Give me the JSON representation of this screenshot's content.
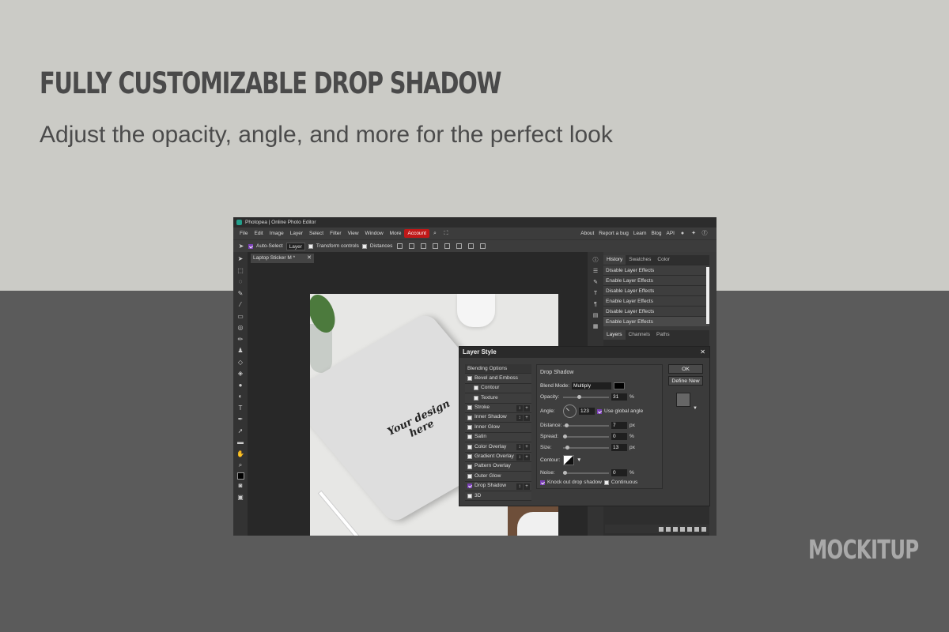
{
  "headline": "FULLY CUSTOMIZABLE DROP SHADOW",
  "subheadline": "Adjust the opacity, angle, and more for the perfect look",
  "brand": "MOCKITUP",
  "colors": {
    "top_bg": "#cbcbc6",
    "bottom_bg": "#5b5b5b",
    "accent_account": "#c01818",
    "check_purple": "#7a3fb5"
  },
  "app": {
    "title": "Photopea | Online Photo Editor",
    "menu": [
      "File",
      "Edit",
      "Image",
      "Layer",
      "Select",
      "Filter",
      "View",
      "Window",
      "More",
      "Account"
    ],
    "menu_right": [
      "About",
      "Report a bug",
      "Learn",
      "Blog",
      "API"
    ],
    "options": {
      "auto_select_label": "Auto-Select",
      "layer_select": "Layer",
      "transform_label": "Transform controls",
      "distances_label": "Distances"
    },
    "doc_tab": "Laptop Sticker M",
    "doc_tab_modified": "*",
    "history_tabs": [
      "History",
      "Swatches",
      "Color"
    ],
    "history_items": [
      "Disable Layer Effects",
      "Enable Layer Effects",
      "Disable Layer Effects",
      "Enable Layer Effects",
      "Disable Layer Effects",
      "Enable Layer Effects"
    ],
    "layer_tabs": [
      "Layers",
      "Channels",
      "Paths"
    ],
    "canvas_text": [
      "Your design",
      "here"
    ]
  },
  "dialog": {
    "title": "Layer Style",
    "ok_label": "OK",
    "define_new_label": "Define New",
    "list_header": "Blending Options",
    "list": [
      {
        "label": "Bevel and Emboss",
        "checked": false,
        "indent": false,
        "pm": false
      },
      {
        "label": "Contour",
        "checked": false,
        "indent": true,
        "pm": false
      },
      {
        "label": "Texture",
        "checked": false,
        "indent": true,
        "pm": false
      },
      {
        "label": "Stroke",
        "checked": false,
        "indent": false,
        "pm": true
      },
      {
        "label": "Inner Shadow",
        "checked": false,
        "indent": false,
        "pm": true
      },
      {
        "label": "Inner Glow",
        "checked": false,
        "indent": false,
        "pm": false
      },
      {
        "label": "Satin",
        "checked": false,
        "indent": false,
        "pm": false
      },
      {
        "label": "Color Overlay",
        "checked": false,
        "indent": false,
        "pm": true
      },
      {
        "label": "Gradient Overlay",
        "checked": false,
        "indent": false,
        "pm": true
      },
      {
        "label": "Pattern Overlay",
        "checked": false,
        "indent": false,
        "pm": false
      },
      {
        "label": "Outer Glow",
        "checked": false,
        "indent": false,
        "pm": false
      },
      {
        "label": "Drop Shadow",
        "checked": true,
        "indent": false,
        "pm": true
      },
      {
        "label": "3D",
        "checked": false,
        "indent": false,
        "pm": false
      }
    ],
    "section_title": "Drop Shadow",
    "blend_mode_label": "Blend Mode:",
    "blend_mode": "Multiply",
    "opacity_label": "Opacity:",
    "opacity": "31",
    "angle_label": "Angle:",
    "angle": "123",
    "use_global_angle_label": "Use global angle",
    "distance_label": "Distance:",
    "distance": "7",
    "spread_label": "Spread:",
    "spread": "0",
    "size_label": "Size:",
    "size": "13",
    "contour_label": "Contour:",
    "noise_label": "Noise:",
    "noise": "0",
    "knock_out_label": "Knock out drop shadow",
    "continuous_label": "Continuous",
    "unit_px": "px",
    "unit_pct": "%"
  }
}
